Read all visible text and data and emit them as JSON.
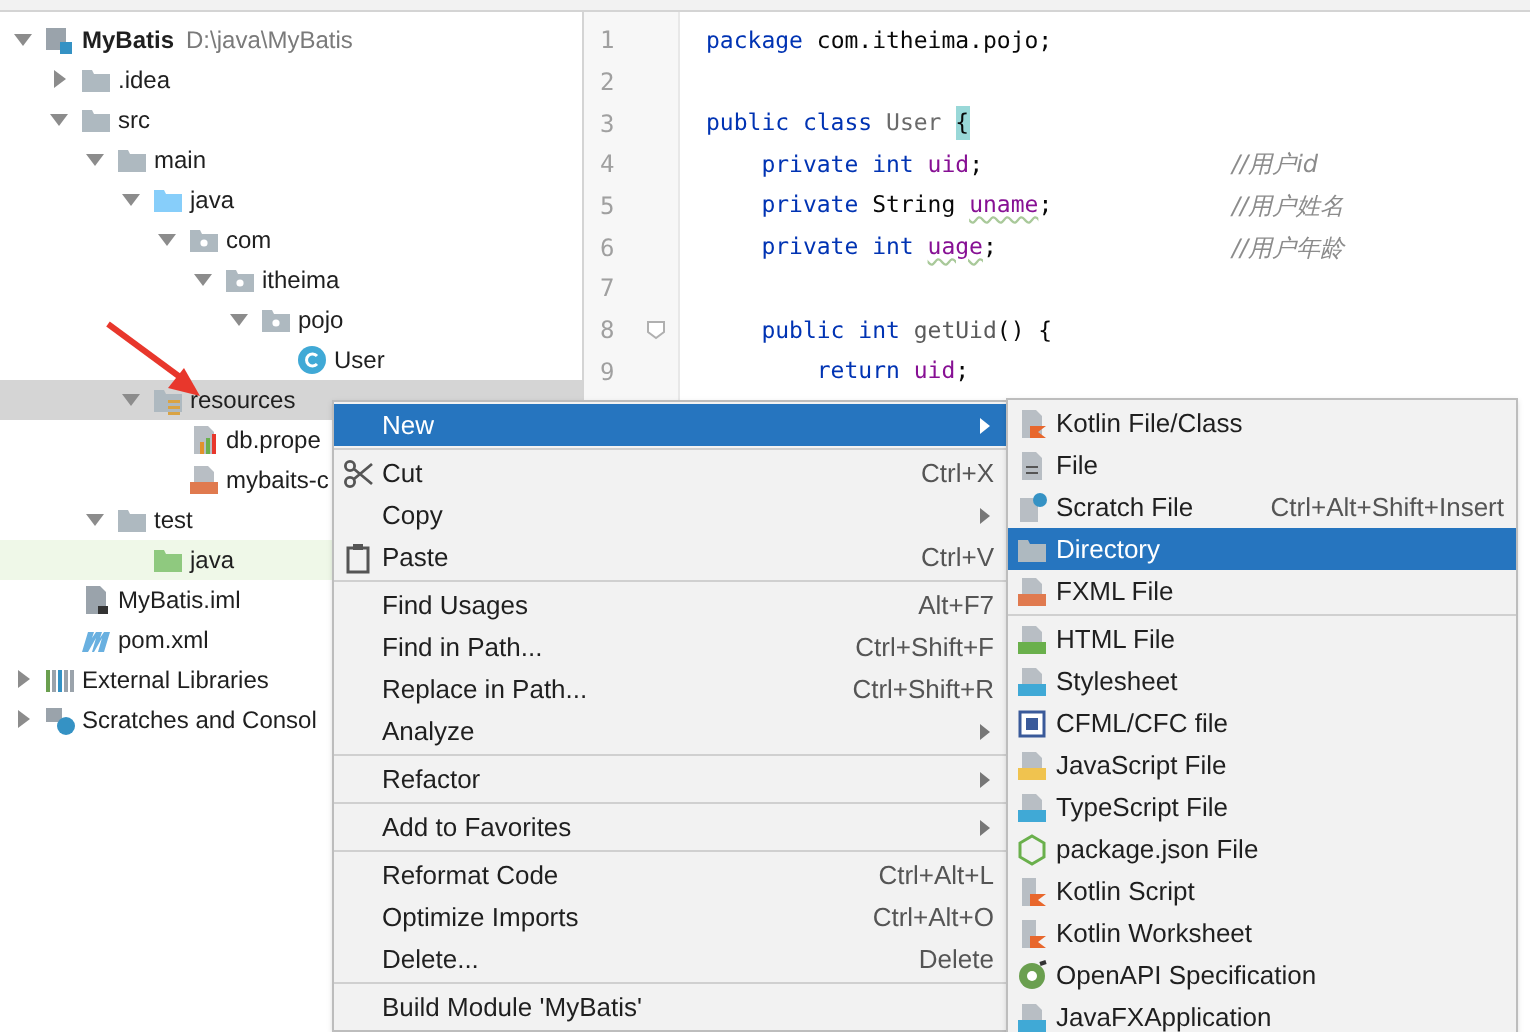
{
  "project_tree": [
    {
      "label": "MyBatis",
      "path": "D:\\java\\MyBatis",
      "kind": "module",
      "expanded": true,
      "selected": false,
      "children": [
        {
          "label": ".idea",
          "kind": "folder",
          "expanded": false,
          "selected": false
        },
        {
          "label": "src",
          "kind": "folder",
          "expanded": true,
          "selected": false,
          "children": [
            {
              "label": "main",
              "kind": "folder",
              "expanded": true,
              "selected": false,
              "children": [
                {
                  "label": "java",
                  "kind": "source-folder",
                  "expanded": true,
                  "selected": false,
                  "children": [
                    {
                      "label": "com",
                      "kind": "package",
                      "expanded": true,
                      "selected": false,
                      "children": [
                        {
                          "label": "itheima",
                          "kind": "package",
                          "expanded": true,
                          "selected": false,
                          "children": [
                            {
                              "label": "pojo",
                              "kind": "package",
                              "expanded": true,
                              "selected": false,
                              "children": [
                                {
                                  "label": "User",
                                  "kind": "class",
                                  "selected": false
                                }
                              ]
                            }
                          ]
                        }
                      ]
                    }
                  ]
                },
                {
                  "label": "resources",
                  "kind": "resources-folder",
                  "expanded": true,
                  "selected": true,
                  "children": [
                    {
                      "label": "db.prope",
                      "kind": "properties",
                      "selected": false
                    },
                    {
                      "label": "mybaits-c",
                      "kind": "xml",
                      "selected": false
                    }
                  ]
                }
              ]
            },
            {
              "label": "test",
              "kind": "folder",
              "expanded": true,
              "selected": false,
              "children": [
                {
                  "label": "java",
                  "kind": "test-folder",
                  "selected": false
                }
              ]
            }
          ]
        },
        {
          "label": "MyBatis.iml",
          "kind": "iml",
          "selected": false
        },
        {
          "label": "pom.xml",
          "kind": "maven",
          "selected": false
        }
      ]
    },
    {
      "label": "External Libraries",
      "kind": "libraries",
      "expanded": false,
      "selected": false
    },
    {
      "label": "Scratches and Consol",
      "kind": "scratches",
      "expanded": false,
      "selected": false
    }
  ],
  "editor": {
    "lines": [
      {
        "number": "1",
        "tokens": [
          {
            "kind": "keyword",
            "text": "package"
          },
          {
            "kind": "plain",
            "text": " com.itheima.pojo;"
          }
        ]
      },
      {
        "number": "2"
      },
      {
        "number": "3",
        "tokens": [
          {
            "kind": "keyword",
            "text": "public class"
          },
          {
            "kind": "class-name",
            "text": " User "
          },
          {
            "kind": "brace-match",
            "text": "{"
          }
        ]
      },
      {
        "number": "4",
        "tokens": [
          {
            "kind": "keyword",
            "text": "    private int"
          },
          {
            "kind": "field",
            "text": " uid"
          },
          {
            "kind": "plain",
            "text": ";"
          }
        ],
        "comment": "//用户id"
      },
      {
        "number": "5",
        "tokens": [
          {
            "kind": "keyword",
            "text": "    private"
          },
          {
            "kind": "plain",
            "text": " String "
          },
          {
            "kind": "field-typo",
            "text": "uname"
          },
          {
            "kind": "plain",
            "text": ";"
          }
        ],
        "comment": "//用户姓名"
      },
      {
        "number": "6",
        "tokens": [
          {
            "kind": "keyword",
            "text": "    private int "
          },
          {
            "kind": "field-typo",
            "text": "uage"
          },
          {
            "kind": "plain",
            "text": ";"
          }
        ],
        "comment": "//用户年龄"
      },
      {
        "number": "7"
      },
      {
        "number": "8",
        "fold": true,
        "tokens": [
          {
            "kind": "keyword",
            "text": "    public int"
          },
          {
            "kind": "method",
            "text": " getUid"
          },
          {
            "kind": "plain",
            "text": "() {"
          }
        ]
      },
      {
        "number": "9",
        "tokens": [
          {
            "kind": "keyword",
            "text": "        return"
          },
          {
            "kind": "field",
            "text": " uid"
          },
          {
            "kind": "plain",
            "text": ";"
          }
        ]
      }
    ]
  },
  "context_menu": {
    "groups": [
      [
        {
          "label": "New",
          "submenu": true,
          "selected": true
        }
      ],
      [
        {
          "label": "Cut",
          "shortcut": "Ctrl+X",
          "kind": "scissors",
          "submenu": false,
          "selected": false
        },
        {
          "label": "Copy",
          "submenu": true,
          "selected": false
        },
        {
          "label": "Paste",
          "shortcut": "Ctrl+V",
          "kind": "clipboard",
          "submenu": false,
          "selected": false
        }
      ],
      [
        {
          "label": "Find Usages",
          "shortcut": "Alt+F7",
          "submenu": false,
          "selected": false
        },
        {
          "label": "Find in Path...",
          "shortcut": "Ctrl+Shift+F",
          "submenu": false,
          "selected": false
        },
        {
          "label": "Replace in Path...",
          "shortcut": "Ctrl+Shift+R",
          "submenu": false,
          "selected": false
        },
        {
          "label": "Analyze",
          "submenu": true,
          "selected": false
        }
      ],
      [
        {
          "label": "Refactor",
          "submenu": true,
          "selected": false
        }
      ],
      [
        {
          "label": "Add to Favorites",
          "submenu": true,
          "selected": false
        }
      ],
      [
        {
          "label": "Reformat Code",
          "shortcut": "Ctrl+Alt+L",
          "submenu": false,
          "selected": false
        },
        {
          "label": "Optimize Imports",
          "shortcut": "Ctrl+Alt+O",
          "submenu": false,
          "selected": false
        },
        {
          "label": "Delete...",
          "shortcut": "Delete",
          "submenu": false,
          "selected": false
        }
      ],
      [
        {
          "label": "Build Module 'MyBatis'",
          "submenu": false,
          "selected": false
        }
      ]
    ]
  },
  "new_submenu": {
    "groups": [
      [
        {
          "label": "Kotlin File/Class",
          "kind": "kotlin-file",
          "selected": false
        },
        {
          "label": "File",
          "kind": "file",
          "selected": false
        },
        {
          "label": "Scratch File",
          "shortcut": "Ctrl+Alt+Shift+Insert",
          "kind": "scratch",
          "selected": false
        },
        {
          "label": "Directory",
          "kind": "folder",
          "selected": true
        },
        {
          "label": "FXML File",
          "kind": "xml",
          "selected": false
        }
      ],
      [
        {
          "label": "HTML File",
          "kind": "html",
          "selected": false
        },
        {
          "label": "Stylesheet",
          "kind": "css",
          "selected": false
        },
        {
          "label": "CFML/CFC file",
          "kind": "cfml",
          "selected": false
        },
        {
          "label": "JavaScript File",
          "kind": "js",
          "selected": false
        },
        {
          "label": "TypeScript File",
          "kind": "ts",
          "selected": false
        },
        {
          "label": "package.json File",
          "kind": "nodejs",
          "selected": false
        },
        {
          "label": "Kotlin Script",
          "kind": "kotlin",
          "selected": false
        },
        {
          "label": "Kotlin Worksheet",
          "kind": "kotlin",
          "selected": false
        },
        {
          "label": "OpenAPI Specification",
          "kind": "openapi",
          "selected": false
        },
        {
          "label": "JavaFXApplication",
          "kind": "javafx",
          "selected": false
        }
      ]
    ]
  }
}
